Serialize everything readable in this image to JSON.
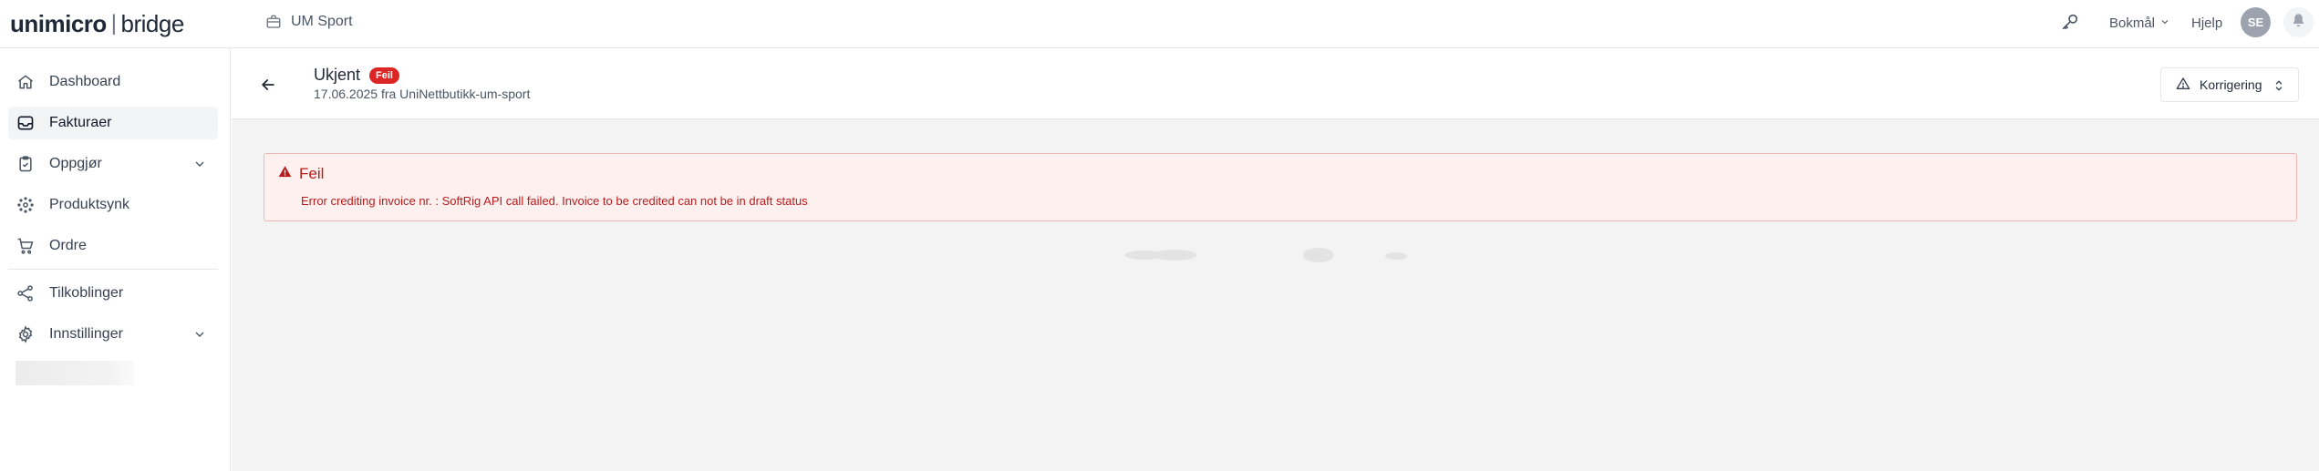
{
  "app": {
    "logo_brand": "unimicro",
    "logo_separator": "|",
    "logo_product": "bridge",
    "company": "UM Sport"
  },
  "header": {
    "language": "Bokmål",
    "help": "Hjelp",
    "avatar_initials": "SE"
  },
  "sidebar": {
    "items": [
      {
        "label": "Dashboard",
        "icon": "home-icon"
      },
      {
        "label": "Fakturaer",
        "icon": "inbox-icon",
        "active": true
      },
      {
        "label": "Oppgjør",
        "icon": "clipboard-check-icon",
        "expandable": true
      },
      {
        "label": "Produktsynk",
        "icon": "sync-dots-icon"
      },
      {
        "label": "Ordre",
        "icon": "cart-icon"
      },
      {
        "label": "Tilkoblinger",
        "icon": "share-icon"
      },
      {
        "label": "Innstillinger",
        "icon": "gear-icon",
        "expandable": true
      }
    ]
  },
  "page": {
    "title": "Ukjent",
    "status_badge": "Feil",
    "subtitle": "17.06.2025 fra UniNettbutikk-um-sport",
    "action_label": "Korrigering"
  },
  "alert": {
    "title": "Feil",
    "message": "Error crediting invoice nr. : SoftRig API call failed. Invoice to be credited can not be in draft status"
  },
  "colors": {
    "error": "#b91c1c",
    "error_bg": "#fdf0ef",
    "badge": "#dc2626",
    "main_bg": "#f3f3f3"
  }
}
